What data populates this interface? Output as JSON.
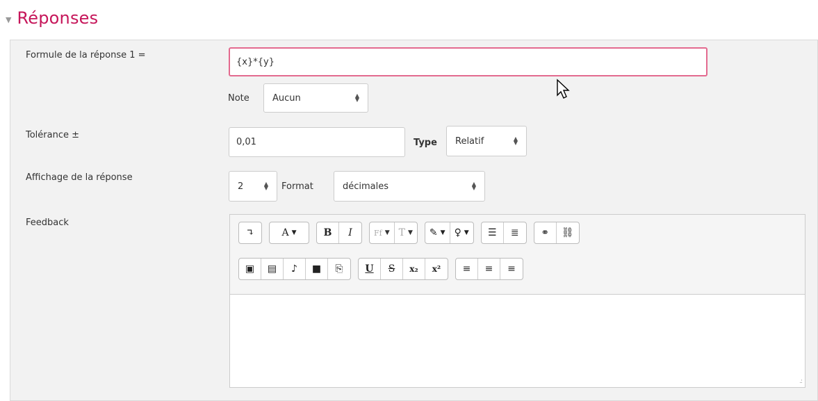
{
  "section": {
    "title": "Réponses"
  },
  "form": {
    "answer_formula_label": "Formule de la réponse 1 =",
    "answer_formula_value": "{x}*{y}",
    "grade_label": "Note",
    "grade_value": "Aucun",
    "tolerance_label": "Tolérance ±",
    "tolerance_value": "0,01",
    "type_label": "Type",
    "type_value": "Relatif",
    "display_label": "Affichage de la réponse",
    "display_value": "2",
    "format_label": "Format",
    "format_value": "décimales",
    "feedback_label": "Feedback"
  },
  "editor": {
    "row1": [
      {
        "name": "collapse-toolbar-button",
        "label": "↴"
      },
      {
        "name": "text-style-button",
        "label": "A",
        "dropdown": true
      },
      {
        "name": "bold-button",
        "label": "B"
      },
      {
        "name": "italic-button",
        "label": "I"
      },
      {
        "name": "font-family-button",
        "label": "Ff",
        "dropdown": true
      },
      {
        "name": "font-size-button",
        "label": "T",
        "dropdown": true
      },
      {
        "name": "font-color-button",
        "label": "✎",
        "dropdown": true
      },
      {
        "name": "background-color-button",
        "label": "♀",
        "dropdown": true
      },
      {
        "name": "unordered-list-button",
        "label": "☰"
      },
      {
        "name": "ordered-list-button",
        "label": "≣"
      },
      {
        "name": "link-button",
        "label": "⚭"
      },
      {
        "name": "unlink-button",
        "label": "⛓"
      }
    ],
    "row2": [
      {
        "name": "insert-image-button",
        "label": "▣"
      },
      {
        "name": "insert-media-button",
        "label": "▤"
      },
      {
        "name": "record-audio-button",
        "label": "♪"
      },
      {
        "name": "record-video-button",
        "label": "■"
      },
      {
        "name": "manage-files-button",
        "label": "⎘"
      },
      {
        "name": "underline-button",
        "label": "U"
      },
      {
        "name": "strikethrough-button",
        "label": "S"
      },
      {
        "name": "subscript-button",
        "label": "x₂"
      },
      {
        "name": "superscript-button",
        "label": "x²"
      },
      {
        "name": "align-left-button",
        "label": "≡"
      },
      {
        "name": "align-center-button",
        "label": "≡"
      },
      {
        "name": "align-right-button",
        "label": "≡"
      }
    ]
  },
  "colors": {
    "accent": "#c6165a",
    "focus_border": "#e36a8f",
    "panel_bg": "#f2f2f2"
  }
}
